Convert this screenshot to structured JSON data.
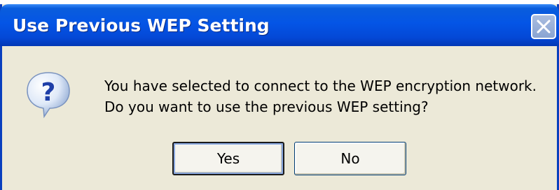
{
  "window": {
    "title": "Use Previous WEP Setting",
    "close_icon": "close-icon"
  },
  "dialog": {
    "icon": "question-icon",
    "message_line1": "You have selected to connect to the WEP encryption network.",
    "message_line2": "Do you want to use the previous WEP setting?"
  },
  "buttons": {
    "yes_label": "Yes",
    "no_label": "No"
  },
  "colors": {
    "titlebar": "#0455e6",
    "window_bg": "#ece9d8",
    "border": "#0a3fbe"
  }
}
